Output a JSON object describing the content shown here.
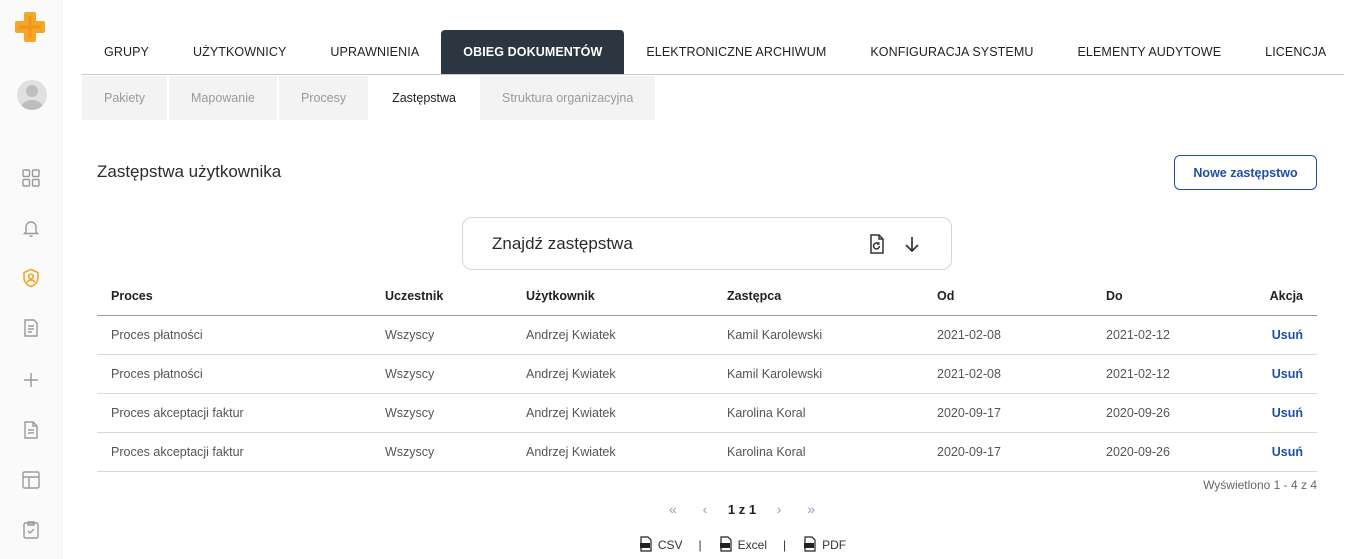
{
  "tabs": [
    {
      "label": "GRUPY"
    },
    {
      "label": "UŻYTKOWNICY"
    },
    {
      "label": "UPRAWNIENIA"
    },
    {
      "label": "OBIEG DOKUMENTÓW",
      "active": true
    },
    {
      "label": "ELEKTRONICZNE ARCHIWUM"
    },
    {
      "label": "KONFIGURACJA SYSTEMU"
    },
    {
      "label": "ELEMENTY AUDYTOWE"
    },
    {
      "label": "LICENCJA"
    }
  ],
  "subtabs": [
    {
      "label": "Pakiety"
    },
    {
      "label": "Mapowanie"
    },
    {
      "label": "Procesy"
    },
    {
      "label": "Zastępstwa",
      "active": true
    },
    {
      "label": "Struktura organizacyjna"
    }
  ],
  "page": {
    "title": "Zastępstwa użytkownika",
    "new_button": "Nowe zastępstwo"
  },
  "search": {
    "title": "Znajdź zastępstwa"
  },
  "table": {
    "headers": [
      "Proces",
      "Uczestnik",
      "Użytkownik",
      "Zastępca",
      "Od",
      "Do",
      "Akcja"
    ],
    "rows": [
      [
        "Proces płatności",
        "Wszyscy",
        "Andrzej Kwiatek",
        "Kamil Karolewski",
        "2021-02-08",
        "2021-02-12",
        "Usuń"
      ],
      [
        "Proces płatności",
        "Wszyscy",
        "Andrzej Kwiatek",
        "Kamil Karolewski",
        "2021-02-08",
        "2021-02-12",
        "Usuń"
      ],
      [
        "Proces akceptacji faktur",
        "Wszyscy",
        "Andrzej Kwiatek",
        "Karolina Koral",
        "2020-09-17",
        "2020-09-26",
        "Usuń"
      ],
      [
        "Proces akceptacji faktur",
        "Wszyscy",
        "Andrzej Kwiatek",
        "Karolina Koral",
        "2020-09-17",
        "2020-09-26",
        "Usuń"
      ]
    ]
  },
  "summary": "Wyświetlono 1 - 4 z 4",
  "pager": {
    "info": "1 z 1",
    "first": "«",
    "prev": "‹",
    "next": "›",
    "last": "»"
  },
  "exports": {
    "csv": "CSV",
    "excel": "Excel",
    "pdf": "PDF",
    "separator": "|"
  },
  "colors": {
    "accent": "#1e4fa8",
    "active_tab_bg": "#2c3640",
    "logo": "#f5a623"
  }
}
